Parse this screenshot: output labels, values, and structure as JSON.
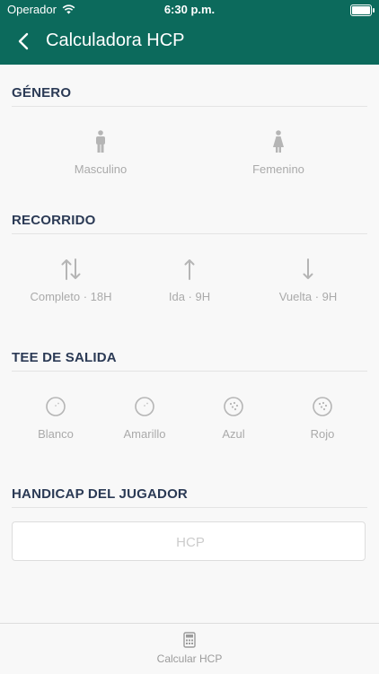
{
  "status_bar": {
    "carrier": "Operador",
    "time": "6:30 p.m."
  },
  "header": {
    "title": "Calculadora HCP"
  },
  "gender": {
    "title": "GÉNERO",
    "options": [
      {
        "label": "Masculino",
        "icon": "male-icon"
      },
      {
        "label": "Femenino",
        "icon": "female-icon"
      }
    ]
  },
  "route": {
    "title": "RECORRIDO",
    "options": [
      {
        "label": "Completo · 18H",
        "icon": "arrows-up-down-icon"
      },
      {
        "label": "Ida · 9H",
        "icon": "arrow-up-icon"
      },
      {
        "label": "Vuelta · 9H",
        "icon": "arrow-down-icon"
      }
    ]
  },
  "tee": {
    "title": "TEE DE SALIDA",
    "options": [
      {
        "label": "Blanco",
        "icon": "golf-ball-icon"
      },
      {
        "label": "Amarillo",
        "icon": "golf-ball-icon"
      },
      {
        "label": "Azul",
        "icon": "golf-ball-icon"
      },
      {
        "label": "Rojo",
        "icon": "golf-ball-icon"
      }
    ]
  },
  "handicap": {
    "title": "HANDICAP DEL JUGADOR",
    "placeholder": "HCP",
    "value": ""
  },
  "tab_bar": {
    "items": [
      {
        "label": "Calcular HCP",
        "icon": "calculator-icon"
      }
    ]
  },
  "colors": {
    "accent": "#0c6a5c",
    "section_title": "#2b3a55",
    "muted": "#aaaaaa"
  }
}
